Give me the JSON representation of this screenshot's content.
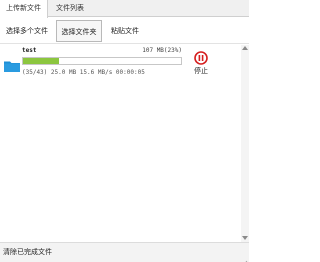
{
  "tabs": [
    {
      "label": "上传新文件",
      "active": true
    },
    {
      "label": "文件列表",
      "active": false
    }
  ],
  "toolbar": {
    "select_multiple_label": "选择多个文件",
    "select_folder_label": "选择文件夹",
    "paste_label": "粘贴文件"
  },
  "upload": {
    "file_name": "test",
    "size_text": "107 MB(23%)",
    "progress": 0.23,
    "stats_text": "(35/43) 25.0 MB 15.6 MB/s 00:00:05",
    "stop_label": "停止",
    "icon": "folder-icon",
    "stop_icon": "pause-icon"
  },
  "footer": {
    "clear_label": "清除已完成文件"
  },
  "colors": {
    "progress_fill": "#8cc63f",
    "folder": "#1e8fd6",
    "stop": "#d61f1f"
  }
}
